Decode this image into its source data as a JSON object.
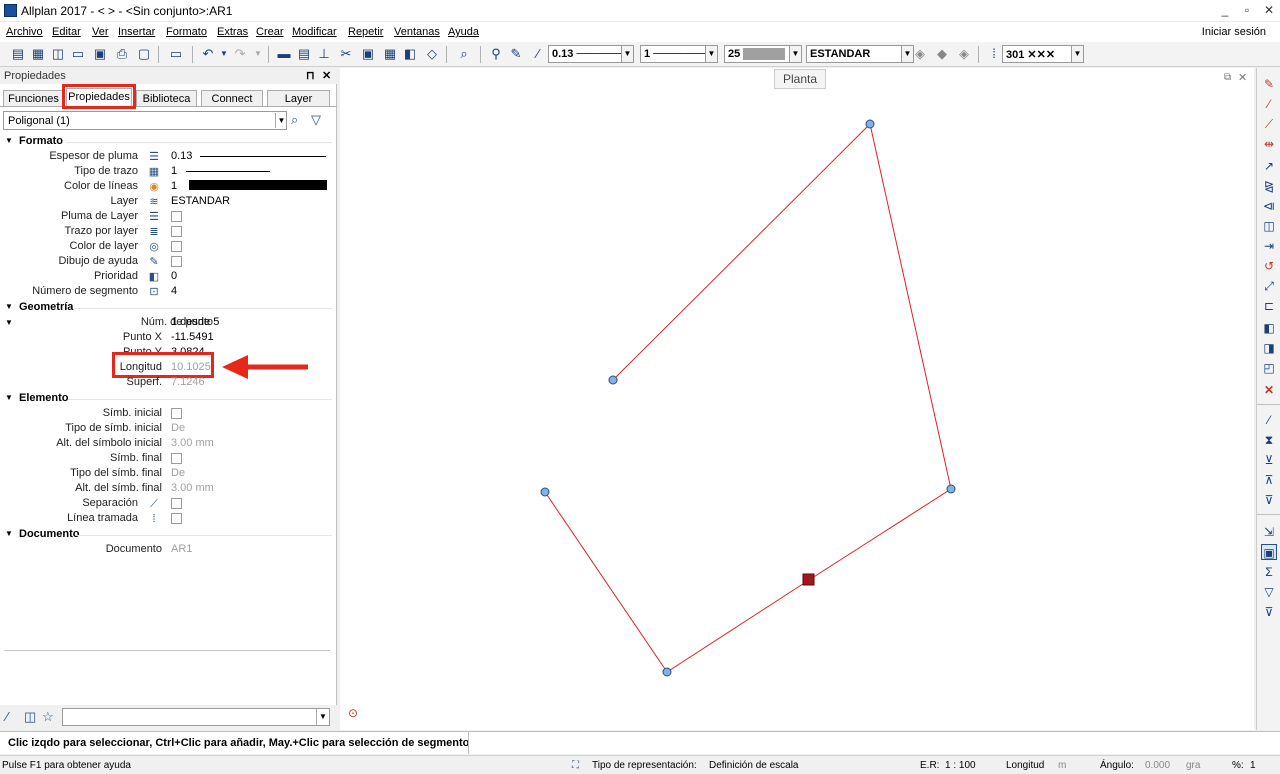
{
  "window": {
    "title": "Allplan 2017 - <      > - <Sin conjunto>:AR1",
    "min": "_",
    "restore": "▫",
    "close": "✕"
  },
  "menu": [
    "Archivo",
    "Editar",
    "Ver",
    "Insertar",
    "Formato",
    "Extras",
    "Crear",
    "Modificar",
    "Repetir",
    "Ventanas",
    "Ayuda"
  ],
  "login": "Iniciar sesión",
  "toolbar": {
    "pen": "0.13",
    "line": "1",
    "color": "25",
    "layer": "ESTANDAR",
    "hatch": "301"
  },
  "panel": {
    "title": "Propiedades",
    "pin": "⊓",
    "close": "✕",
    "tabs": [
      "Funciones",
      "Propiedades",
      "Biblioteca",
      "Connect",
      "Layer"
    ],
    "selection": "Poligonal (1)",
    "sections": {
      "formato": "Formato",
      "geometria": "Geometría",
      "elemento": "Elemento",
      "documento": "Documento"
    },
    "formato": {
      "pen_label": "Espesor de pluma",
      "pen_value": "0.13",
      "line_label": "Tipo de trazo",
      "line_value": "1",
      "color_label": "Color de líneas",
      "color_value": "1",
      "layer_label": "Layer",
      "layer_value": "ESTANDAR",
      "pen_by_layer": "Pluma de Layer",
      "line_by_layer": "Trazo por layer",
      "color_by_layer": "Color de layer",
      "aux": "Dibujo de ayuda",
      "priority_label": "Prioridad",
      "priority_value": "0",
      "segments_label": "Número de segmento",
      "segments_value": "4"
    },
    "geometria": {
      "point_label": "Núm. de punto",
      "point_value": "1 desde 5",
      "x_label": "Punto X",
      "x_value": "-11.5491",
      "y_label": "Punto Y",
      "y_value": "3.0824",
      "length_label": "Longitud",
      "length_value": "10.1025",
      "area_label": "Superf.",
      "area_value": "7.1246"
    },
    "elemento": {
      "start_sym": "Símb. inicial",
      "start_type_label": "Tipo de símb. inicial",
      "start_type_value": "De",
      "start_height_label": "Alt. del símbolo inicial",
      "start_height_value": "3.00 mm",
      "end_sym": "Símb. final",
      "end_type_label": "Tipo del símb. final",
      "end_type_value": "De",
      "end_height_label": "Alt. del símb. final",
      "end_height_value": "3.00 mm",
      "separation": "Separación",
      "dashed": "Línea tramada"
    },
    "documento": {
      "label": "Documento",
      "value": "AR1"
    }
  },
  "canvas": {
    "view_label": "Planta"
  },
  "status": {
    "message": "Clic izqdo para seleccionar, Ctrl+Clic para añadir, May.+Clic para selección de segmento",
    "help": "Pulse F1 para obtener ayuda",
    "repr_label": "Tipo de representación:",
    "repr_value": "Definición de escala",
    "scale_label": "E.R:",
    "scale_value": "1 : 100",
    "length_label": "Longitud",
    "length_unit": "m",
    "angle_label": "Ángulo:",
    "angle_value": "0.000",
    "angle_unit": "gra",
    "percent_label": "%:",
    "percent_value": "1"
  },
  "colors": {
    "polyline": "#e02020",
    "vertex": "#7fb2e5",
    "highlight": "#e6281c",
    "selected_vertex": "#a3171f"
  }
}
